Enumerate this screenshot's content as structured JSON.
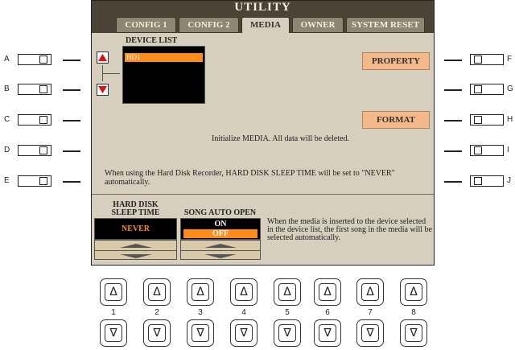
{
  "title": "UTILITY",
  "tabs": [
    {
      "label": "CONFIG 1",
      "active": false
    },
    {
      "label": "CONFIG 2",
      "active": false
    },
    {
      "label": "MEDIA",
      "active": true
    },
    {
      "label": "OWNER",
      "active": false
    },
    {
      "label": "SYSTEM RESET",
      "active": false
    }
  ],
  "device_list": {
    "heading": "DEVICE LIST",
    "items": [
      "HD1"
    ],
    "selected": "HD1"
  },
  "property_button": "PROPERTY",
  "init_text": "Initialize MEDIA. All data will be deleted.",
  "format_button": "FORMAT",
  "hdd_note": "When using the Hard Disk Recorder, HARD DISK SLEEP TIME will be set to \"NEVER\" automatically.",
  "hdd_sleep": {
    "label_line1": "HARD DISK",
    "label_line2": "SLEEP TIME",
    "value": "NEVER"
  },
  "song_auto_open": {
    "label": "SONG AUTO OPEN",
    "options": [
      "ON",
      "OFF"
    ],
    "selected": "OFF"
  },
  "media_note": "When the media is inserted to the device selected in the device list, the first song in the media will be selected automatically.",
  "side_left": [
    "A",
    "B",
    "C",
    "D",
    "E"
  ],
  "side_right": [
    "F",
    "G",
    "H",
    "I",
    "J"
  ],
  "bottom_numbers": [
    "1",
    "2",
    "3",
    "4",
    "5",
    "6",
    "7",
    "8"
  ],
  "glyphs": {
    "up": "Δ",
    "down": "∇"
  },
  "colors": {
    "accent": "#ff8c1a",
    "titlebar": "#4b4436",
    "screen_bg": "#d6cfbd",
    "button_orange": "#f3b98b"
  }
}
